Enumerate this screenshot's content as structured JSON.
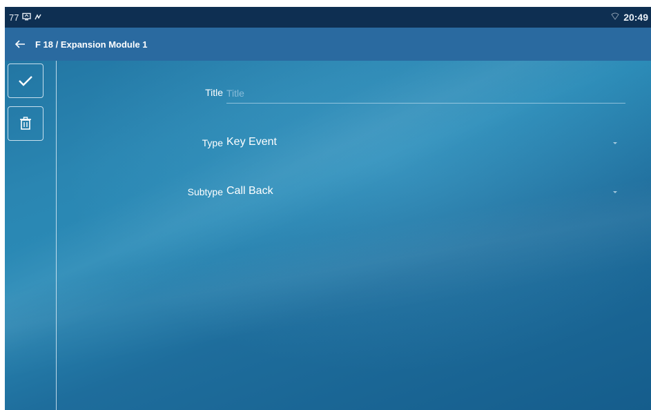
{
  "status_bar": {
    "left_text": "77",
    "left_icons": [
      "screen-share-icon",
      "signal-icon"
    ],
    "right_icons": [
      "wifi-icon"
    ],
    "time": "20:49"
  },
  "title_bar": {
    "back_icon": "arrow-left-icon",
    "title": "F 18 / Expansion Module 1"
  },
  "actions": {
    "save_icon": "checkmark-icon",
    "delete_icon": "trash-icon"
  },
  "form": {
    "title": {
      "label": "Title",
      "value": "",
      "placeholder": "Title"
    },
    "type": {
      "label": "Type",
      "value": "Key Event"
    },
    "subtype": {
      "label": "Subtype",
      "value": "Call Back"
    }
  },
  "colors": {
    "status_bar_bg": "#0e2f52",
    "title_bar_bg": "#2a6aa0",
    "background": "#2a86b2"
  }
}
